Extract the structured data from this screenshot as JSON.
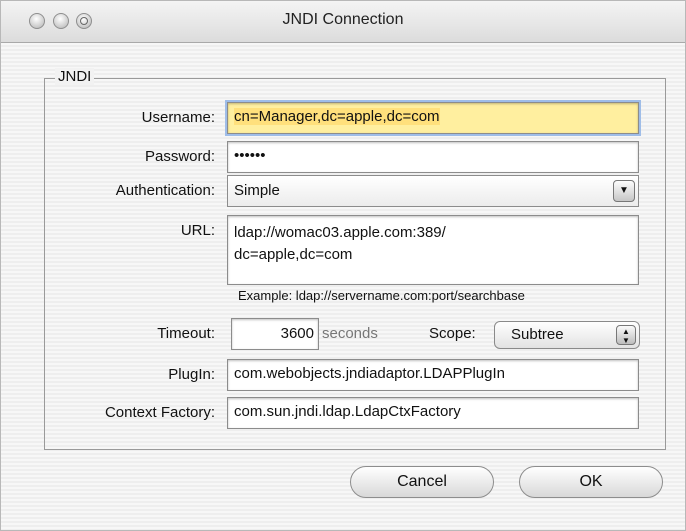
{
  "window": {
    "title": "JNDI Connection"
  },
  "group": {
    "legend": "JNDI"
  },
  "form": {
    "username": {
      "label": "Username:",
      "value": "cn=Manager,dc=apple,dc=com"
    },
    "password": {
      "label": "Password:",
      "value": "••••••"
    },
    "authentication": {
      "label": "Authentication:",
      "value": "Simple"
    },
    "url": {
      "label": "URL:",
      "line1": "ldap://womac03.apple.com:389/",
      "line2": "dc=apple,dc=com",
      "example": "Example: ldap://servername.com:port/searchbase"
    },
    "timeout": {
      "label": "Timeout:",
      "value": "3600",
      "units": "seconds"
    },
    "scope": {
      "label": "Scope:",
      "value": "Subtree"
    },
    "plugin": {
      "label": "PlugIn:",
      "value": "com.webobjects.jndiadaptor.LDAPPlugIn"
    },
    "context_factory": {
      "label": "Context Factory:",
      "value": "com.sun.jndi.ldap.LdapCtxFactory"
    }
  },
  "buttons": {
    "cancel": "Cancel",
    "ok": "OK"
  }
}
